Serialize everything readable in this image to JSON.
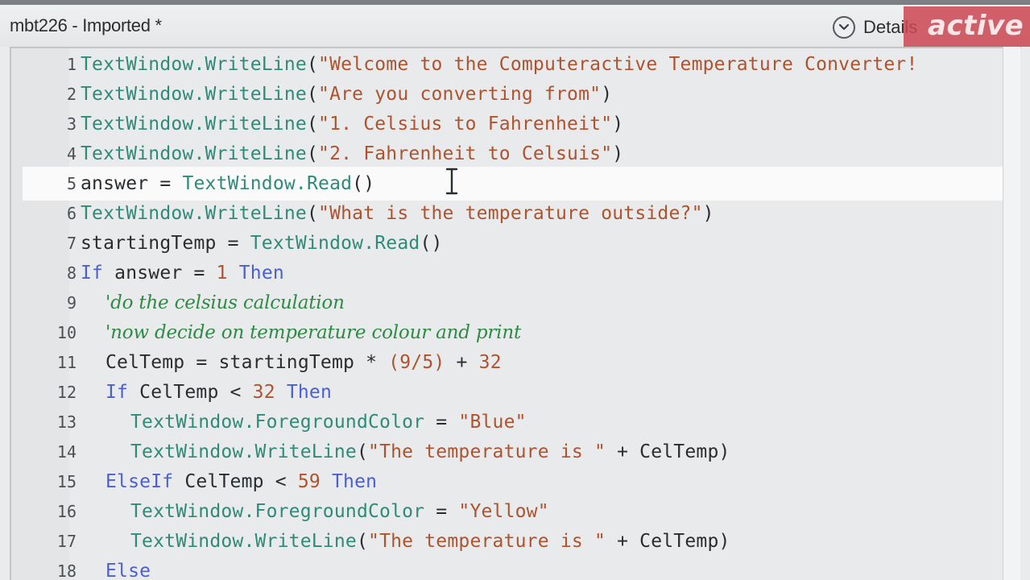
{
  "window": {
    "title": "mbt226 - Imported *",
    "details_label": "Details",
    "watermark": "active"
  },
  "colors": {
    "object": "#2f8a7a",
    "method": "#2f8a7a",
    "plain": "#2a2d30",
    "string": "#b0522e",
    "keyword": "#4a5fd4",
    "number": "#b0522e",
    "comment": "#2e8b45",
    "operator": "#2a2d30"
  },
  "editor": {
    "current_line": 5,
    "lines": [
      {
        "n": "1",
        "indent": 0,
        "tokens": [
          {
            "t": "TextWindow.WriteLine",
            "c": "object"
          },
          {
            "t": "(",
            "c": "plain"
          },
          {
            "t": "\"Welcome to the Computeractive Temperature Converter!",
            "c": "string"
          }
        ]
      },
      {
        "n": "2",
        "indent": 0,
        "tokens": [
          {
            "t": "TextWindow.WriteLine",
            "c": "object"
          },
          {
            "t": "(",
            "c": "plain"
          },
          {
            "t": "\"Are you converting from\"",
            "c": "string"
          },
          {
            "t": ")",
            "c": "plain"
          }
        ]
      },
      {
        "n": "3",
        "indent": 0,
        "tokens": [
          {
            "t": "TextWindow.WriteLine",
            "c": "object"
          },
          {
            "t": "(",
            "c": "plain"
          },
          {
            "t": "\"1. Celsius to Fahrenheit\"",
            "c": "string"
          },
          {
            "t": ")",
            "c": "plain"
          }
        ]
      },
      {
        "n": "4",
        "indent": 0,
        "tokens": [
          {
            "t": "TextWindow.WriteLine",
            "c": "object"
          },
          {
            "t": "(",
            "c": "plain"
          },
          {
            "t": "\"2. Fahrenheit to Celsuis\"",
            "c": "string"
          },
          {
            "t": ")",
            "c": "plain"
          }
        ]
      },
      {
        "n": "5",
        "indent": 0,
        "tokens": [
          {
            "t": "answer",
            "c": "plain"
          },
          {
            "t": " = ",
            "c": "operator"
          },
          {
            "t": "TextWindow.Read",
            "c": "object"
          },
          {
            "t": "()",
            "c": "plain"
          }
        ]
      },
      {
        "n": "6",
        "indent": 0,
        "tokens": [
          {
            "t": "TextWindow.WriteLine",
            "c": "object"
          },
          {
            "t": "(",
            "c": "plain"
          },
          {
            "t": "\"What is the temperature outside?\"",
            "c": "string"
          },
          {
            "t": ")",
            "c": "plain"
          }
        ]
      },
      {
        "n": "7",
        "indent": 0,
        "tokens": [
          {
            "t": "startingTemp",
            "c": "plain"
          },
          {
            "t": " = ",
            "c": "operator"
          },
          {
            "t": "TextWindow.Read",
            "c": "object"
          },
          {
            "t": "()",
            "c": "plain"
          }
        ]
      },
      {
        "n": "8",
        "indent": 0,
        "tokens": [
          {
            "t": "If",
            "c": "keyword"
          },
          {
            "t": " answer = ",
            "c": "plain"
          },
          {
            "t": "1",
            "c": "number"
          },
          {
            "t": " ",
            "c": "plain"
          },
          {
            "t": "Then",
            "c": "keyword"
          }
        ]
      },
      {
        "n": "9",
        "indent": 1,
        "tokens": [
          {
            "t": "'do the celsius calculation",
            "c": "comment"
          }
        ]
      },
      {
        "n": "10",
        "indent": 1,
        "tokens": [
          {
            "t": "'now decide on temperature colour and print",
            "c": "comment"
          }
        ]
      },
      {
        "n": "11",
        "indent": 1,
        "tokens": [
          {
            "t": "CelTemp",
            "c": "plain"
          },
          {
            "t": " = ",
            "c": "operator"
          },
          {
            "t": "startingTemp",
            "c": "plain"
          },
          {
            "t": " * ",
            "c": "operator"
          },
          {
            "t": "(9/5)",
            "c": "number"
          },
          {
            "t": " + ",
            "c": "operator"
          },
          {
            "t": "32",
            "c": "number"
          }
        ]
      },
      {
        "n": "12",
        "indent": 1,
        "tokens": [
          {
            "t": "If",
            "c": "keyword"
          },
          {
            "t": " CelTemp < ",
            "c": "plain"
          },
          {
            "t": "32",
            "c": "number"
          },
          {
            "t": " ",
            "c": "plain"
          },
          {
            "t": "Then",
            "c": "keyword"
          }
        ]
      },
      {
        "n": "13",
        "indent": 2,
        "tokens": [
          {
            "t": "TextWindow.ForegroundColor",
            "c": "object"
          },
          {
            "t": " = ",
            "c": "operator"
          },
          {
            "t": "\"Blue\"",
            "c": "string"
          }
        ]
      },
      {
        "n": "14",
        "indent": 2,
        "tokens": [
          {
            "t": "TextWindow.WriteLine",
            "c": "object"
          },
          {
            "t": "(",
            "c": "plain"
          },
          {
            "t": "\"The temperature is \"",
            "c": "string"
          },
          {
            "t": " + CelTemp)",
            "c": "plain"
          }
        ]
      },
      {
        "n": "15",
        "indent": 1,
        "tokens": [
          {
            "t": "ElseIf",
            "c": "keyword"
          },
          {
            "t": " CelTemp < ",
            "c": "plain"
          },
          {
            "t": "59",
            "c": "number"
          },
          {
            "t": " ",
            "c": "plain"
          },
          {
            "t": "Then",
            "c": "keyword"
          }
        ]
      },
      {
        "n": "16",
        "indent": 2,
        "tokens": [
          {
            "t": "TextWindow.ForegroundColor",
            "c": "object"
          },
          {
            "t": " = ",
            "c": "operator"
          },
          {
            "t": "\"Yellow\"",
            "c": "string"
          }
        ]
      },
      {
        "n": "17",
        "indent": 2,
        "tokens": [
          {
            "t": "TextWindow.WriteLine",
            "c": "object"
          },
          {
            "t": "(",
            "c": "plain"
          },
          {
            "t": "\"The temperature is \"",
            "c": "string"
          },
          {
            "t": " + CelTemp)",
            "c": "plain"
          }
        ]
      },
      {
        "n": "18",
        "indent": 1,
        "tokens": [
          {
            "t": "Else",
            "c": "keyword"
          }
        ]
      }
    ]
  }
}
